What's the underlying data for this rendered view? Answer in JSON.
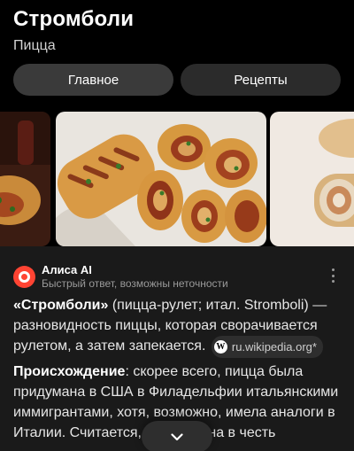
{
  "header": {
    "title": "Стромболи",
    "subtitle": "Пицца"
  },
  "tabs": [
    {
      "label": "Главное",
      "active": true
    },
    {
      "label": "Рецепты",
      "active": false
    }
  ],
  "gallery": {
    "images": [
      "stromboli-photo-left",
      "stromboli-photo-main",
      "stromboli-photo-right"
    ]
  },
  "answer": {
    "source_name": "Алиса AI",
    "disclaimer": "Быстрый ответ, возможны неточности",
    "p1_bold": "«Стромболи»",
    "p1_text": " (пицца-рулет; итал. Stromboli) — разновидность пиццы, которая сворачивается рулетом, а затем запекается.",
    "wiki_source": "ru.wikipedia.org*",
    "p2_bold": "Происхождение",
    "p2_text": ": скорее всего, пицца была придумана в США в Филадельфии итальянскими иммигрантами, хотя, возможно, имела аналоги в Италии. Считается, что названа в честь"
  },
  "colors": {
    "background": "#000000",
    "card": "#1a1a1a",
    "tab_bg": "#2b2b2b",
    "alice_brand": "#ff4433"
  }
}
